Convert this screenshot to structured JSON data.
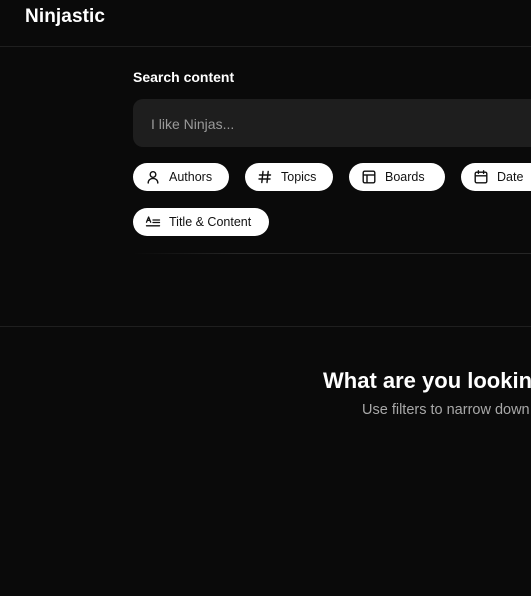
{
  "app": {
    "brand": "Ninjastic"
  },
  "search": {
    "label": "Search content",
    "placeholder": "I like Ninjas...",
    "value": ""
  },
  "filters": [
    {
      "label": "Authors",
      "icon": "user-icon"
    },
    {
      "label": "Topics",
      "icon": "hash-icon"
    },
    {
      "label": "Boards",
      "icon": "layout-icon"
    },
    {
      "label": "Date",
      "icon": "calendar-icon"
    },
    {
      "label": "Title & Content",
      "icon": "text-align-icon"
    }
  ],
  "empty_state": {
    "title": "What are you looking for?",
    "subtitle": "Use filters to narrow down your search"
  },
  "colors": {
    "background": "#0a0a0a",
    "search_box": "#1e1e1e",
    "chip_background": "#ffffff",
    "chip_text": "#111111",
    "subtitle_text": "#a8a8a8"
  }
}
